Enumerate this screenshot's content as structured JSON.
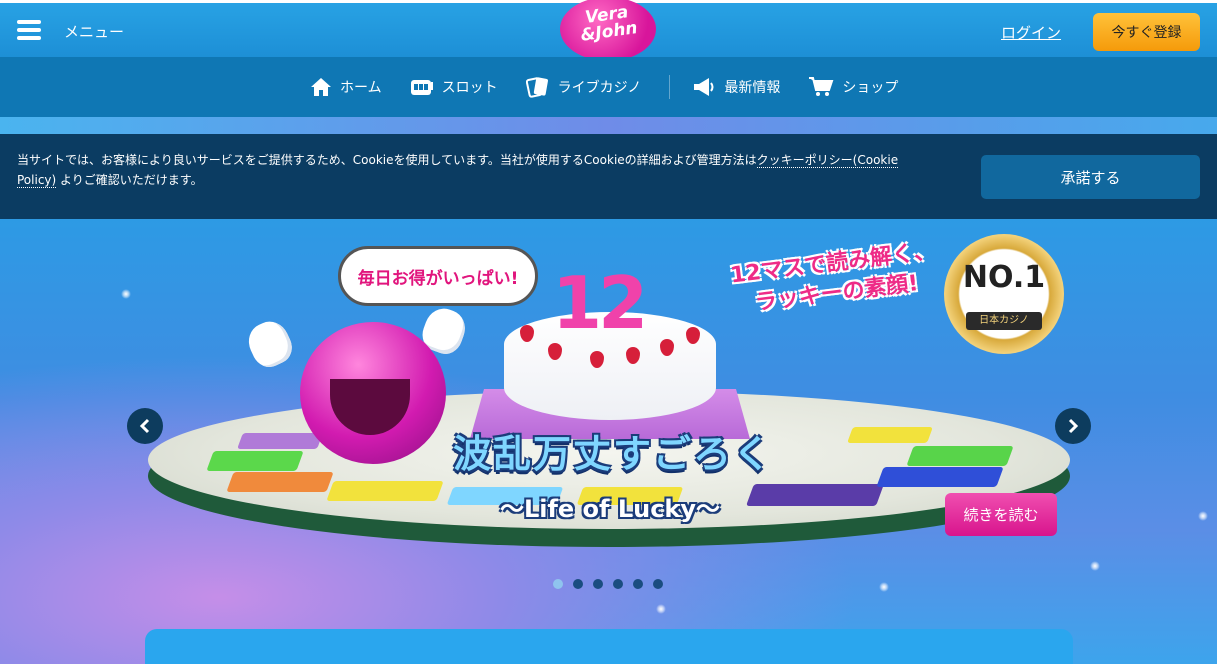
{
  "header": {
    "menu_label": "メニュー",
    "logo_text_line1": "Vera",
    "logo_text_line2": "&John",
    "login_label": "ログイン",
    "register_label": "今すぐ登録"
  },
  "nav": {
    "items": [
      {
        "label": "ホーム",
        "icon": "home-icon"
      },
      {
        "label": "スロット",
        "icon": "slot-machine-icon"
      },
      {
        "label": "ライブカジノ",
        "icon": "cards-icon"
      },
      {
        "label": "最新情報",
        "icon": "megaphone-icon"
      },
      {
        "label": "ショップ",
        "icon": "cart-icon"
      }
    ]
  },
  "cookie": {
    "text_before": "当サイトでは、お客様により良いサービスをご提供するため、Cookieを使用しています。当社が使用するCookieの詳細および管理方法は",
    "link_text": "クッキーポリシー(Cookie Policy)",
    "text_after": " よりご確認いただけます。",
    "accept_label": "承諾する"
  },
  "hero": {
    "speech_bubble": "毎日お得がいっぱい!",
    "cake_number": "12",
    "slogan_line1": "12マスで読み解く、",
    "slogan_line2": "ラッキーの素顔!",
    "badge_main": "NO.1",
    "badge_sub": "日本カジノ",
    "title": "波乱万丈すごろく",
    "subtitle": "〜Life of Lucky〜",
    "read_more_label": "続きを読む",
    "slide_count": 6,
    "active_slide": 1,
    "colors": {
      "accent_pink": "#e1157d",
      "register_orange": "#f59a0a",
      "cookie_bg": "#0b3c62"
    }
  }
}
